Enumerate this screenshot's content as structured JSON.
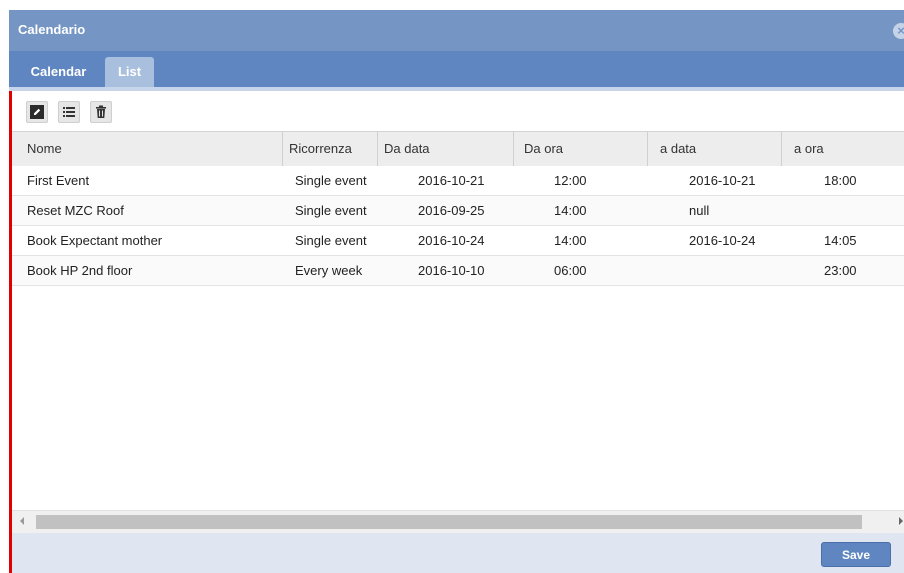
{
  "window": {
    "title": "Calendario"
  },
  "tabs": [
    {
      "label": "Calendar",
      "active": false
    },
    {
      "label": "List",
      "active": true
    }
  ],
  "toolbar": {
    "buttons": [
      {
        "icon": "edit-icon"
      },
      {
        "icon": "list-icon"
      },
      {
        "icon": "trash-icon"
      }
    ]
  },
  "table": {
    "columns": [
      "Nome",
      "Ricorrenza",
      "Da data",
      "Da ora",
      "a data",
      "a ora"
    ],
    "rows": [
      [
        "First Event",
        "Single event",
        "2016-10-21",
        "12:00",
        "2016-10-21",
        "18:00"
      ],
      [
        "Reset MZC Roof",
        "Single event",
        "2016-09-25",
        "14:00",
        "null",
        ""
      ],
      [
        "Book Expectant mother",
        "Single event",
        "2016-10-24",
        "14:00",
        "2016-10-24",
        "14:05"
      ],
      [
        "Book HP 2nd floor",
        "Every week",
        "2016-10-10",
        "06:00",
        "",
        "23:00"
      ]
    ]
  },
  "footer": {
    "save_label": "Save"
  },
  "colors": {
    "titlebar": "#7596c4",
    "tabbar": "#5f86c0",
    "active_tab": "#a9bfde",
    "accent_bar": "#e00000"
  }
}
